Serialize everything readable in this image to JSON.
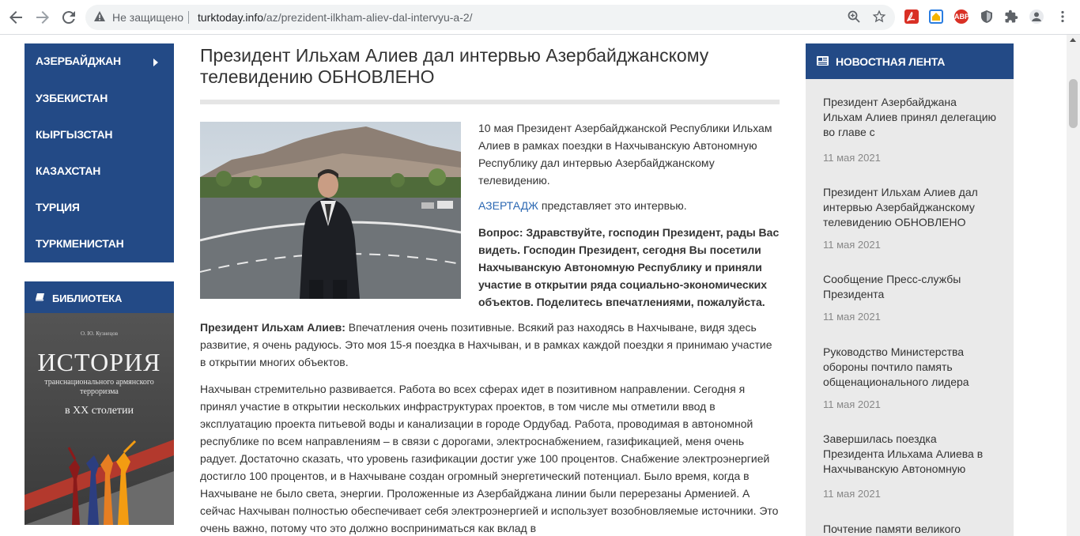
{
  "browser": {
    "insecure_label": "Не защищено",
    "url_host": "turktoday.info",
    "url_path": "/az/prezident-ilkham-aliev-dal-intervyu-a-2/",
    "ext_abp": "ABP"
  },
  "leftnav": {
    "items": [
      {
        "label": "АЗЕРБАЙДЖАН"
      },
      {
        "label": "УЗБЕКИСТАН"
      },
      {
        "label": "КЫРГЫЗСТАН"
      },
      {
        "label": "КАЗАХСТАН"
      },
      {
        "label": "ТУРЦИЯ"
      },
      {
        "label": "ТУРКМЕНИСТАН"
      }
    ]
  },
  "library": {
    "title": "БИБЛИОТЕКА",
    "book_author": "О. Ю. Кузнецов",
    "book_title": "ИСТОРИЯ",
    "book_subtitle": "транснационального армянского терроризма",
    "book_century": "в XX столетии"
  },
  "article": {
    "title": "Президент Ильхам Алиев дал интервью Азербайджанскому телевидению ОБНОВЛЕНО",
    "intro_p1": "10 мая Президент Азербайджанской Республики Ильхам Алиев в рамках поездки в Нахчыванскую Автономную Республику дал интервью Азербайджанскому телевидению.",
    "intro_link": "АЗЕРТАДЖ",
    "intro_p2_rest": " представляет это интервью.",
    "question": "Вопрос: Здравствуйте, господин Президент, рады Вас видеть. Господин Президент, сегодня Вы посетили Нахчыванскую Автономную Республику и приняли участие в открытии ряда социально-экономических объектов. Поделитесь впечатлениями, пожалуйста.",
    "answer_speaker": "Президент Ильхам Алиев:",
    "answer_text": " Впечатления очень позитивные. Всякий раз находясь в Нахчыване, видя здесь развитие, я очень радуюсь. Это моя 15-я поездка в Нахчыван, и в рамках каждой поездки я принимаю участие в открытии многих объектов.",
    "paragraph2": "Нахчыван стремительно развивается. Работа во всех сферах идет в позитивном направлении. Сегодня я принял участие в открытии нескольких инфраструктурах проектов, в том числе мы отметили ввод в эксплуатацию проекта питьевой воды и канализации в городе Ордубад. Работа, проводимая в автономной республике по всем направлениям – в связи с дорогами, электроснабжением, газификацией, меня очень радует. Достаточно сказать, что уровень газификации достиг уже 100 процентов. Снабжение электроэнергией достигло 100 процентов, и в Нахчыване создан огромный энергетический потенциал. Было время, когда в Нахчыване не было света, энергии. Проложенные из Азербайджана линии были перерезаны Арменией. А сейчас Нахчыван полностью обеспечивает себя электроэнергией и использует возобновляемые источники. Это очень важно, потому что это должно восприниматься как вклад в"
  },
  "feed": {
    "title": "НОВОСТНАЯ ЛЕНТА",
    "items": [
      {
        "title": "Президент Азербайджана Ильхам Алиев принял делегацию во главе с",
        "date": "11 мая 2021"
      },
      {
        "title": "Президент Ильхам Алиев дал интервью Азербайджанскому телевидению ОБНОВЛЕНО",
        "date": "11 мая 2021"
      },
      {
        "title": "Сообщение Пресс-службы Президента",
        "date": "11 мая 2021"
      },
      {
        "title": "Руководство Министерства обороны почтило память общенационального лидера",
        "date": "11 мая 2021"
      },
      {
        "title": "Завершилась поездка Президента Ильхама Алиева в Нахчыванскую Автономную",
        "date": "11 мая 2021"
      },
      {
        "title": "Почтение памяти великого",
        "date": ""
      }
    ]
  }
}
